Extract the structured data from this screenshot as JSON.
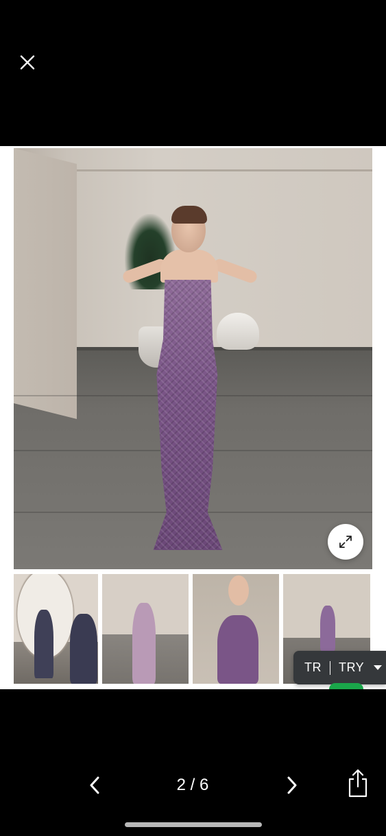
{
  "viewer": {
    "close_icon": "close-icon",
    "expand_icon": "expand-icon"
  },
  "thumbnails": [
    {
      "name": "thumbnail-1",
      "dress_color": "#3f4057"
    },
    {
      "name": "thumbnail-2",
      "dress_color": "#b99ab6"
    },
    {
      "name": "thumbnail-3",
      "dress_color": "#7a5587"
    },
    {
      "name": "thumbnail-4",
      "dress_color": "#8c6a9a"
    }
  ],
  "currency": {
    "country": "TR",
    "code": "TRY"
  },
  "pager": {
    "counter": "2 / 6",
    "prev_icon": "chevron-left-icon",
    "next_icon": "chevron-right-icon",
    "share_icon": "share-icon"
  },
  "colors": {
    "background": "#000000",
    "currency_bg": "#35383b",
    "dress": "#7a5587"
  }
}
